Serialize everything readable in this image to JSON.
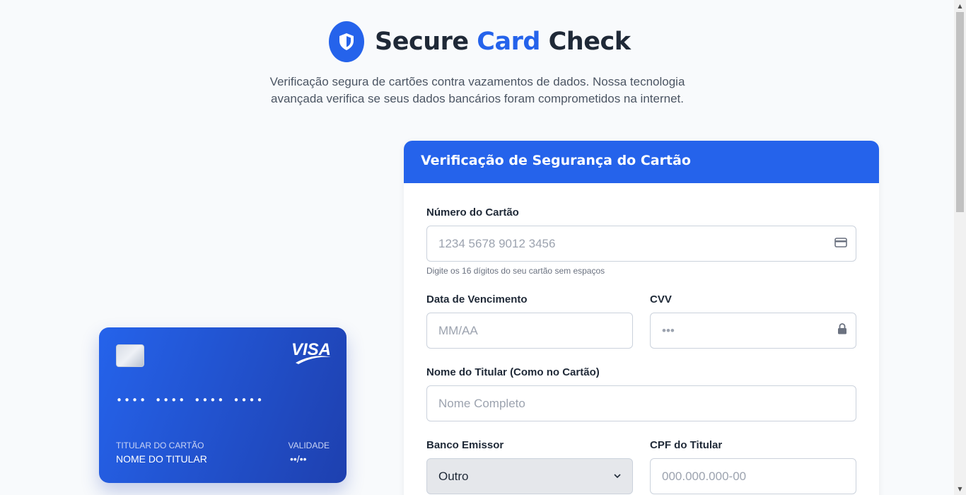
{
  "header": {
    "title_part1": "Secure ",
    "title_accent": "Card",
    "title_part3": " Check",
    "subtitle": "Verificação segura de cartões contra vazamentos de dados. Nossa tecnologia avançada verifica se seus dados bancários foram comprometidos na internet."
  },
  "card_preview": {
    "brand": "VISA",
    "number": "•••• •••• •••• ••••",
    "holder_caption": "TITULAR DO CARTÃO",
    "holder_name": "NOME DO TITULAR",
    "valid_caption": "VALIDADE",
    "valid_value": "••/••"
  },
  "form": {
    "title": "Verificação de Segurança do Cartão",
    "card_number": {
      "label": "Número do Cartão",
      "placeholder": "1234 5678 9012 3456",
      "hint": "Digite os 16 dígitos do seu cartão sem espaços"
    },
    "expiry": {
      "label": "Data de Vencimento",
      "placeholder": "MM/AA"
    },
    "cvv": {
      "label": "CVV",
      "placeholder": "•••"
    },
    "holder": {
      "label": "Nome do Titular (Como no Cartão)",
      "placeholder": "Nome Completo"
    },
    "bank": {
      "label": "Banco Emissor",
      "value": "Outro"
    },
    "cpf": {
      "label": "CPF do Titular",
      "placeholder": "000.000.000-00"
    }
  },
  "colors": {
    "accent": "#2563eb",
    "card_gradient_end": "#1e40af",
    "background": "#f8fafc"
  }
}
